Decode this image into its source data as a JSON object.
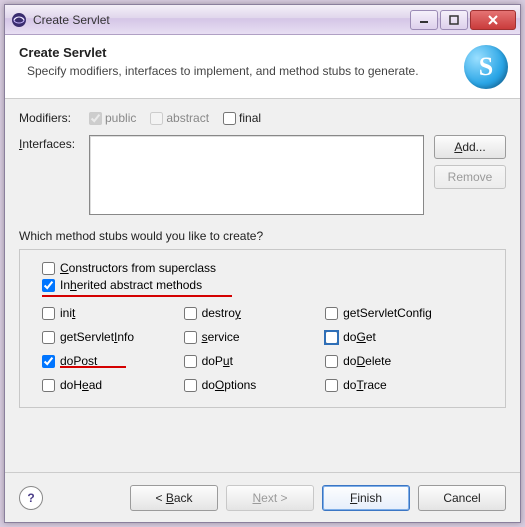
{
  "window": {
    "title": "Create Servlet"
  },
  "banner": {
    "heading": "Create Servlet",
    "sub": "Specify modifiers, interfaces to implement, and method stubs to generate.",
    "icon_letter": "S"
  },
  "modifiers": {
    "label": "Modifiers:",
    "public_label": "public",
    "public_checked": true,
    "public_enabled": false,
    "abstract_label": "abstract",
    "abstract_checked": false,
    "abstract_enabled": false,
    "final_label": "final",
    "final_checked": false,
    "final_enabled": true
  },
  "interfaces": {
    "label": "Interfaces:",
    "add_label": "Add...",
    "remove_label": "Remove"
  },
  "stubs": {
    "question": "Which method stubs would you like to create?",
    "constructors": {
      "label": "Constructors from superclass",
      "checked": false
    },
    "inherited": {
      "label": "Inherited abstract methods",
      "checked": true
    },
    "grid": [
      {
        "name": "init",
        "label": "init",
        "checked": false
      },
      {
        "name": "destroy",
        "label": "destroy",
        "checked": false
      },
      {
        "name": "getServletConfig",
        "label": "getServletConfig",
        "checked": false
      },
      {
        "name": "getServletInfo",
        "label": "getServletInfo",
        "checked": false
      },
      {
        "name": "service",
        "label": "service",
        "checked": false
      },
      {
        "name": "doGet",
        "label": "doGet",
        "checked": false,
        "highlight": true
      },
      {
        "name": "doPost",
        "label": "doPost",
        "checked": true,
        "redline": true
      },
      {
        "name": "doPut",
        "label": "doPut",
        "checked": false
      },
      {
        "name": "doDelete",
        "label": "doDelete",
        "checked": false
      },
      {
        "name": "doHead",
        "label": "doHead",
        "checked": false
      },
      {
        "name": "doOptions",
        "label": "doOptions",
        "checked": false
      },
      {
        "name": "doTrace",
        "label": "doTrace",
        "checked": false
      }
    ]
  },
  "footer": {
    "back": "< Back",
    "next": "Next >",
    "finish": "Finish",
    "cancel": "Cancel"
  }
}
